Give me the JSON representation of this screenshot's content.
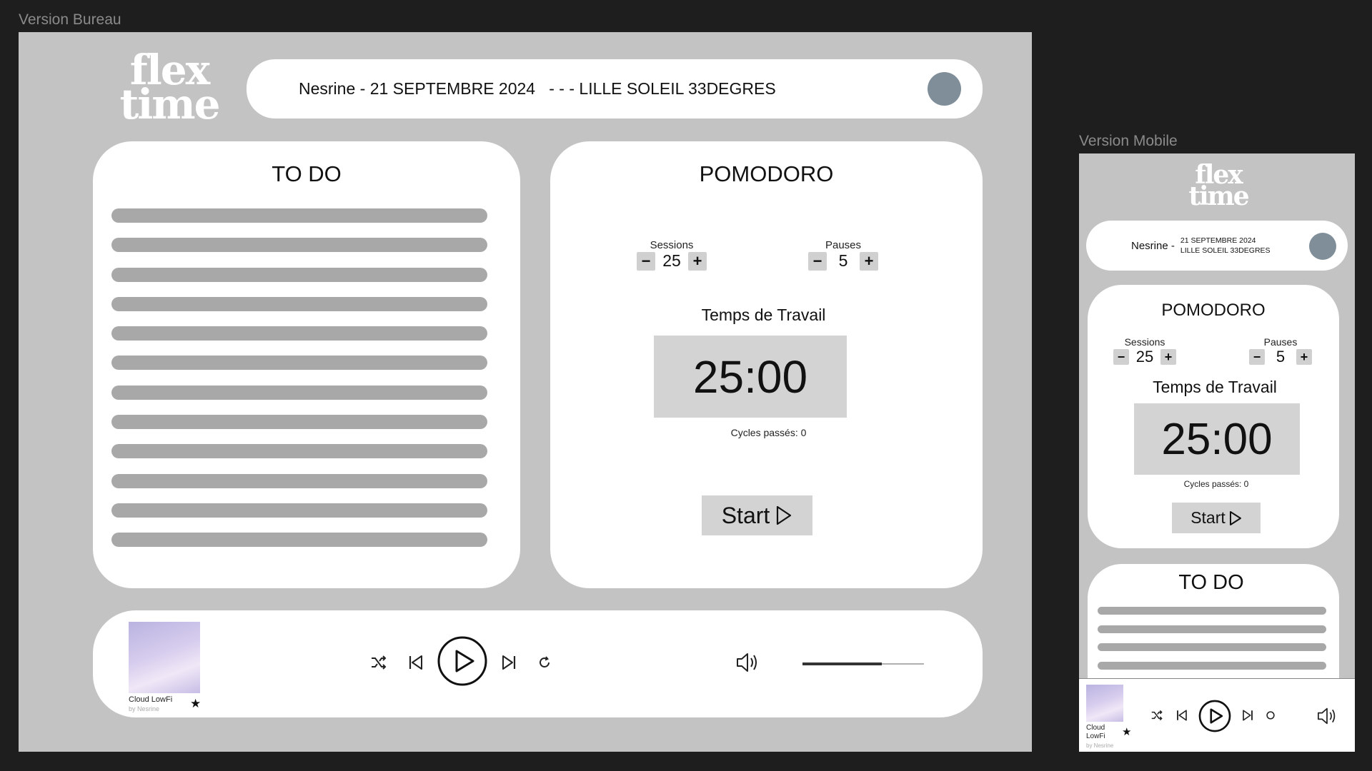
{
  "labels": {
    "desktop": "Version Bureau",
    "mobile": "Version Mobile"
  },
  "logo": {
    "line1": "flex",
    "line2": "time"
  },
  "header": {
    "desktop_text": "Nesrine - 21 SEPTEMBRE 2024   - - - LILLE SOLEIL 33DEGRES",
    "mobile_name": "Nesrine -",
    "mobile_date": "21 SEPTEMBRE 2024",
    "mobile_weather": "LILLE SOLEIL 33DEGRES"
  },
  "todo": {
    "title": "TO DO",
    "desktop_line_count": 12,
    "mobile_line_count": 4
  },
  "pomodoro": {
    "title": "POMODORO",
    "sessions_label": "Sessions",
    "sessions_value": "25",
    "pauses_label": "Pauses",
    "pauses_value": "5",
    "minus": "−",
    "plus": "+",
    "work_label": "Temps de Travail",
    "timer": "25:00",
    "cycles": "Cycles passés: 0",
    "start_label": "Start"
  },
  "player": {
    "track": "Cloud LowFi",
    "artist": "by Nesrine",
    "star": "★",
    "volume_level": 0.65
  },
  "icons": [
    "logo",
    "avatar",
    "shuffle-icon",
    "previous-icon",
    "play-icon",
    "next-icon",
    "repeat-icon",
    "volume-icon",
    "star-icon",
    "play-triangle-icon"
  ]
}
